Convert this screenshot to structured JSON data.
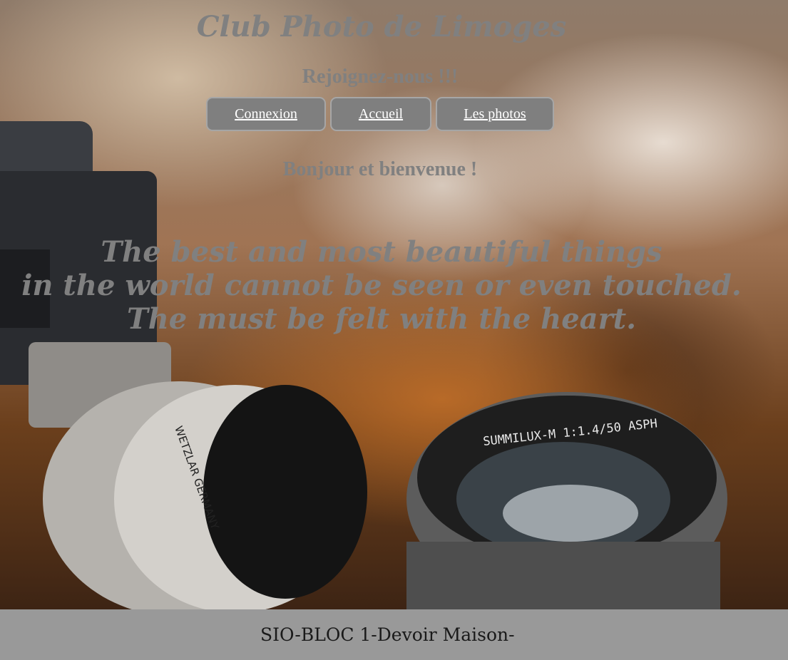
{
  "header": {
    "title": "Club Photo de Limoges",
    "subtitle": "Rejoignez-nous !!!"
  },
  "nav": {
    "items": [
      {
        "label": "Connexion"
      },
      {
        "label": "Accueil"
      },
      {
        "label": "Les photos"
      }
    ]
  },
  "main": {
    "greeting": "Bonjour et bienvenue !",
    "quote": [
      "The best and most beautiful things",
      "in the world cannot be seen or even touched.",
      "The must be felt with the heart."
    ],
    "background_image": {
      "lens_text_left": "WETZLAR GERMANY",
      "lens_text_right": "SUMMILUX-M 1:1.4/50 ASPH"
    }
  },
  "footer": {
    "text": "SIO-BLOC 1-Devoir Maison-"
  },
  "colors": {
    "title_text": "#808080",
    "nav_button_bg": "#7f7f7f",
    "nav_button_text": "#ffffff",
    "footer_bg": "#999999",
    "footer_text": "#1a1a1a"
  }
}
